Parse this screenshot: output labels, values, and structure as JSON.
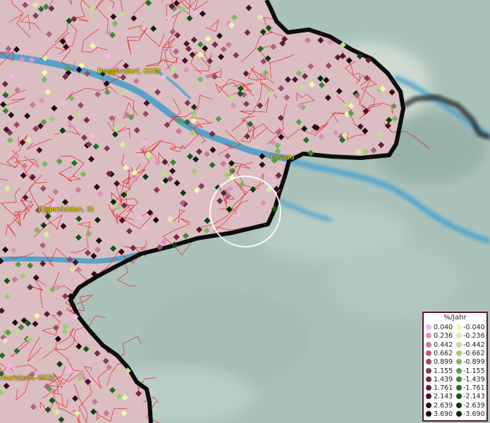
{
  "labels": {
    "deggendorf": "Deggendorf, GKSt",
    "passau": "Passau",
    "eggenfelden": "Eggenfelden, St",
    "traunstein": "raunstein, GKSt"
  },
  "legend": {
    "title": "%/Jahr",
    "positive": [
      {
        "value": "0.040",
        "color": "#f7b8e6"
      },
      {
        "value": "0.236",
        "color": "#dd92be"
      },
      {
        "value": "0.442",
        "color": "#c77a9c"
      },
      {
        "value": "0.662",
        "color": "#b06080"
      },
      {
        "value": "0.899",
        "color": "#9a4a66"
      },
      {
        "value": "1.155",
        "color": "#843a54"
      },
      {
        "value": "1.439",
        "color": "#702c44"
      },
      {
        "value": "1.761",
        "color": "#5c1e34"
      },
      {
        "value": "2.143",
        "color": "#481426"
      },
      {
        "value": "2.639",
        "color": "#330a18"
      },
      {
        "value": "3.690",
        "color": "#1a030a"
      }
    ],
    "negative": [
      {
        "value": "-0.040",
        "color": "#f2f8b4"
      },
      {
        "value": "-0.236",
        "color": "#d8eca2"
      },
      {
        "value": "-0.442",
        "color": "#bde08e"
      },
      {
        "value": "-0.662",
        "color": "#9ccd78"
      },
      {
        "value": "-0.899",
        "color": "#7ab862"
      },
      {
        "value": "-1.155",
        "color": "#58a04a"
      },
      {
        "value": "-1.439",
        "color": "#3c8836"
      },
      {
        "value": "-1.761",
        "color": "#246e26"
      },
      {
        "value": "-2.143",
        "color": "#145618"
      },
      {
        "value": "-2.639",
        "color": "#0a3e10"
      },
      {
        "value": "-3.690",
        "color": "#032606"
      }
    ]
  },
  "colors": {
    "land_region": "#d9bcc0",
    "outside_region": "#a9c0b8",
    "river": "#3d9bc9",
    "border": "#0d0d0d",
    "municipal_lines": "#e0262c",
    "label_text": "#e8e000",
    "highlight_circle": "#ffffff"
  }
}
